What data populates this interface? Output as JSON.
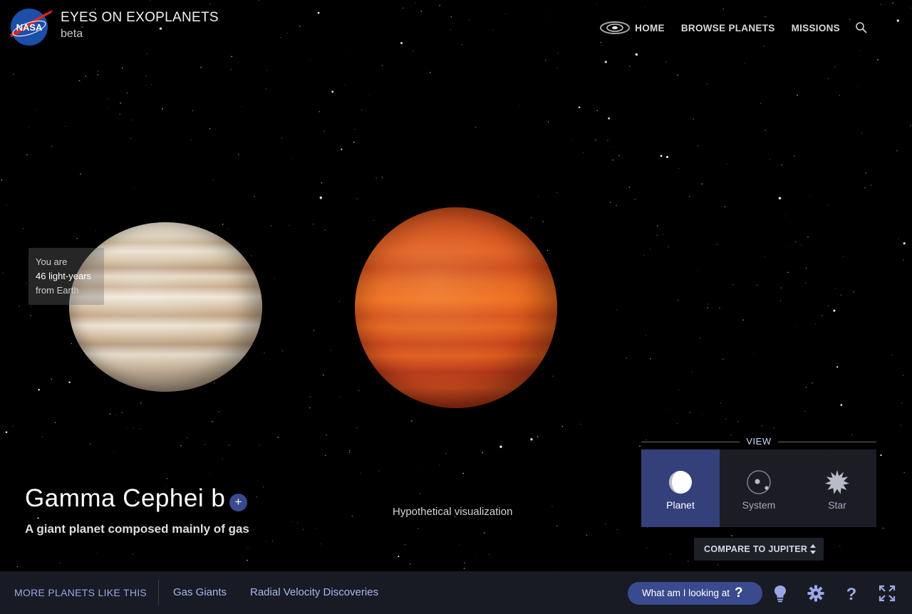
{
  "header": {
    "logo_text": "NASA",
    "title": "EYES ON EXOPLANETS",
    "subtitle": "beta",
    "nav": [
      "HOME",
      "BROWSE PLANETS",
      "MISSIONS"
    ]
  },
  "distance": {
    "prefix": "You are",
    "value": "46 light-years",
    "suffix": "from Earth"
  },
  "planet": {
    "name": "Gamma Cephei b",
    "description": "A giant planet composed mainly of gas",
    "add_label": "+",
    "visualization_note": "Hypothetical visualization"
  },
  "view": {
    "label": "VIEW",
    "options": [
      {
        "label": "Planet",
        "icon": "planet-icon",
        "active": true
      },
      {
        "label": "System",
        "icon": "system-icon",
        "active": false
      },
      {
        "label": "Star",
        "icon": "star-icon",
        "active": false
      }
    ],
    "compare_label": "COMPARE TO JUPITER"
  },
  "footer": {
    "more_label": "MORE PLANETS LIKE THIS",
    "links": [
      "Gas Giants",
      "Radial Velocity Discoveries"
    ],
    "help_label": "What am I looking at",
    "help_glyph": "?"
  },
  "colors": {
    "accent": "#3a4a8e",
    "panel_active": "#34407a",
    "link": "#a9b6ef",
    "footer_bg": "#191b24"
  }
}
